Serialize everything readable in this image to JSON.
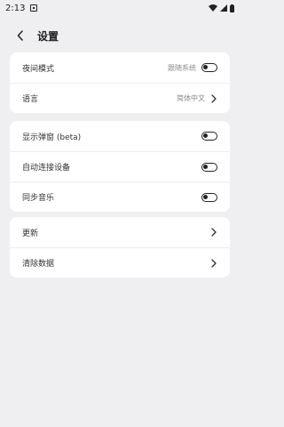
{
  "statusbar": {
    "time": "2:13"
  },
  "appbar": {
    "title": "设置"
  },
  "group1": [
    {
      "label": "夜间模式",
      "value": "跟随系统",
      "control": "toggle",
      "on": false
    },
    {
      "label": "语言",
      "value": "简体中文",
      "control": "chevron"
    }
  ],
  "group2": [
    {
      "label": "显示弹窗 (beta)",
      "control": "toggle",
      "on": false
    },
    {
      "label": "自动连接设备",
      "control": "toggle",
      "on": false
    },
    {
      "label": "同步音乐",
      "control": "toggle",
      "on": false
    }
  ],
  "group3": [
    {
      "label": "更新",
      "control": "chevron"
    },
    {
      "label": "清除数据",
      "control": "chevron"
    }
  ],
  "colors": {
    "background": "#efeff1",
    "card": "#ffffff",
    "text": "#202124",
    "secondary": "#8a8a8a"
  }
}
